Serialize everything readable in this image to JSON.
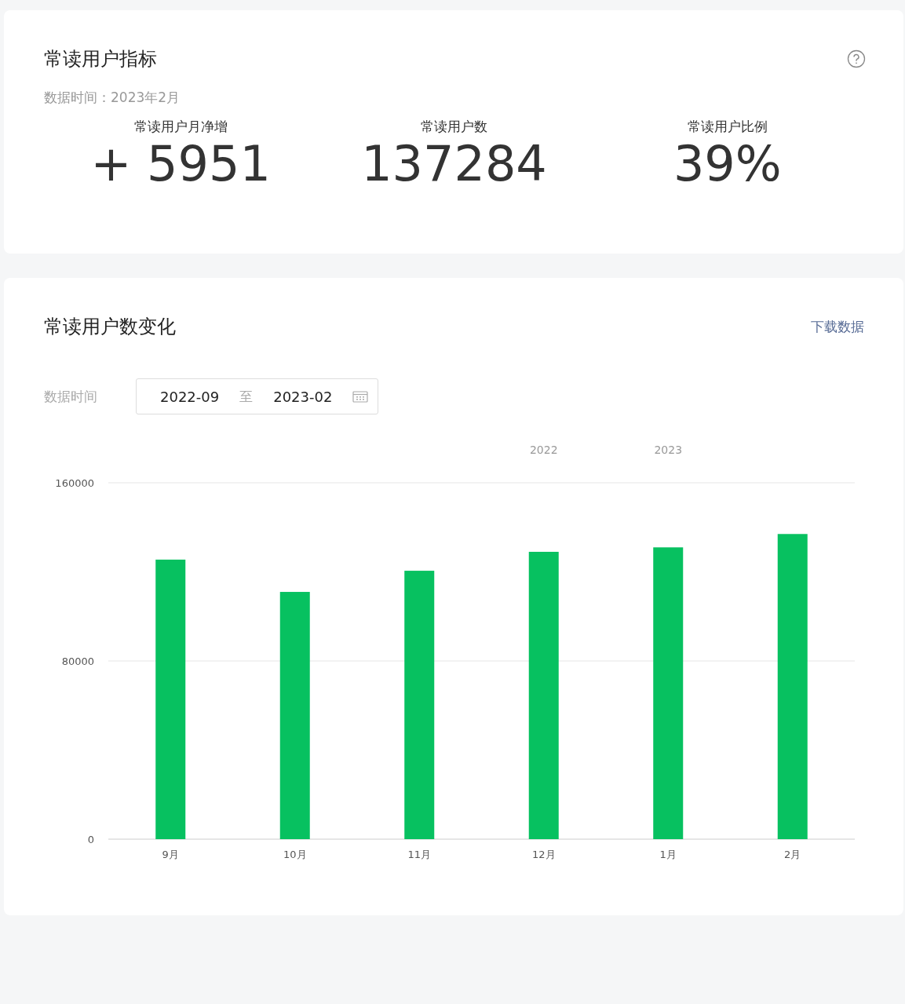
{
  "metrics_card": {
    "title": "常读用户指标",
    "data_time": "数据时间：2023年2月",
    "metrics": [
      {
        "label": "常读用户月净增",
        "value": "+ 5951"
      },
      {
        "label": "常读用户数",
        "value": "137284"
      },
      {
        "label": "常读用户比例",
        "value": "39%"
      }
    ]
  },
  "trend_card": {
    "title": "常读用户数变化",
    "download_link": "下载数据",
    "range_label": "数据时间",
    "range_start": "2022-09",
    "range_separator": "至",
    "range_end": "2023-02",
    "chart_data": {
      "type": "bar",
      "categories": [
        "9月",
        "10月",
        "11月",
        "12月",
        "1月",
        "2月"
      ],
      "series": [
        {
          "color": "#07c160",
          "values": [
            125500,
            111000,
            120500,
            129000,
            131000,
            137000
          ]
        }
      ],
      "ylim": [
        0,
        160000
      ],
      "yticks": [
        0,
        80000,
        160000
      ],
      "annotations": [
        "2022",
        "2023"
      ]
    }
  }
}
